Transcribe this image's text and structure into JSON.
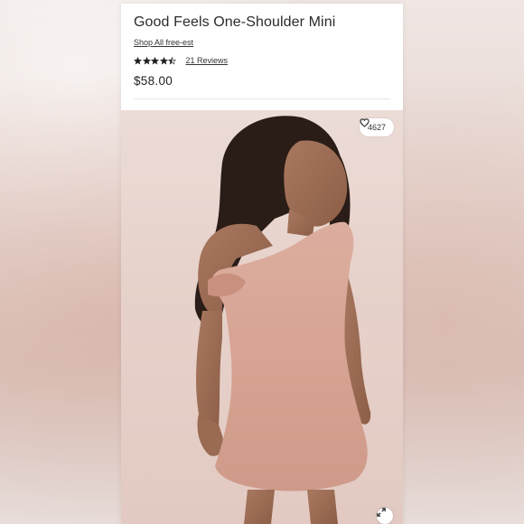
{
  "product": {
    "title": "Good Feels One-Shoulder Mini",
    "shop_link": "Shop All free-est",
    "rating": 4.5,
    "rating_max": 5,
    "reviews_label": "21 Reviews",
    "price": "$58.00"
  },
  "image": {
    "likes_count": "4627",
    "like_icon": "heart-icon",
    "expand_icon": "expand-icon",
    "dress_color": "#d9a89b",
    "background_color": "#e8d4cd"
  }
}
